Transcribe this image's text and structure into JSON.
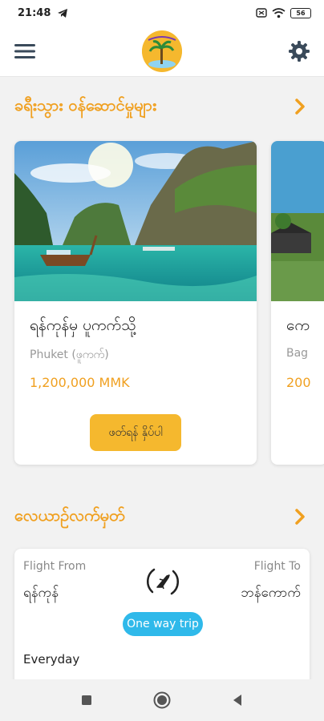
{
  "status_bar": {
    "time": "21:48",
    "battery": "56"
  },
  "header": {
    "menu_icon": "hamburger-menu-icon",
    "logo_icon": "travel-logo-icon",
    "settings_icon": "gear-icon"
  },
  "sections": {
    "services": {
      "title": "ခရီးသွား ဝန်ဆောင်မှုများ"
    },
    "tickets": {
      "title": "လေယာဉ်လက်မှတ်"
    }
  },
  "tours": [
    {
      "title": "ရန်ကုန်မှ ပူကက်သို့",
      "subtitle": "Phuket (ဖူကက်)",
      "price": "1,200,000 MMK",
      "button": "ဖတ်ရန် နှိပ်ပါ"
    },
    {
      "title": "ကေ",
      "subtitle": "Bag",
      "price": "200"
    }
  ],
  "flight": {
    "from_label": "Flight From",
    "from_city": "ရန်ကုန်",
    "to_label": "Flight To",
    "to_city": "ဘန်ကောက်",
    "trip_type": "One way trip",
    "schedule": "Everyday"
  },
  "colors": {
    "accent": "#f0a020",
    "button": "#f5b82e",
    "pill": "#2fb9ea"
  }
}
